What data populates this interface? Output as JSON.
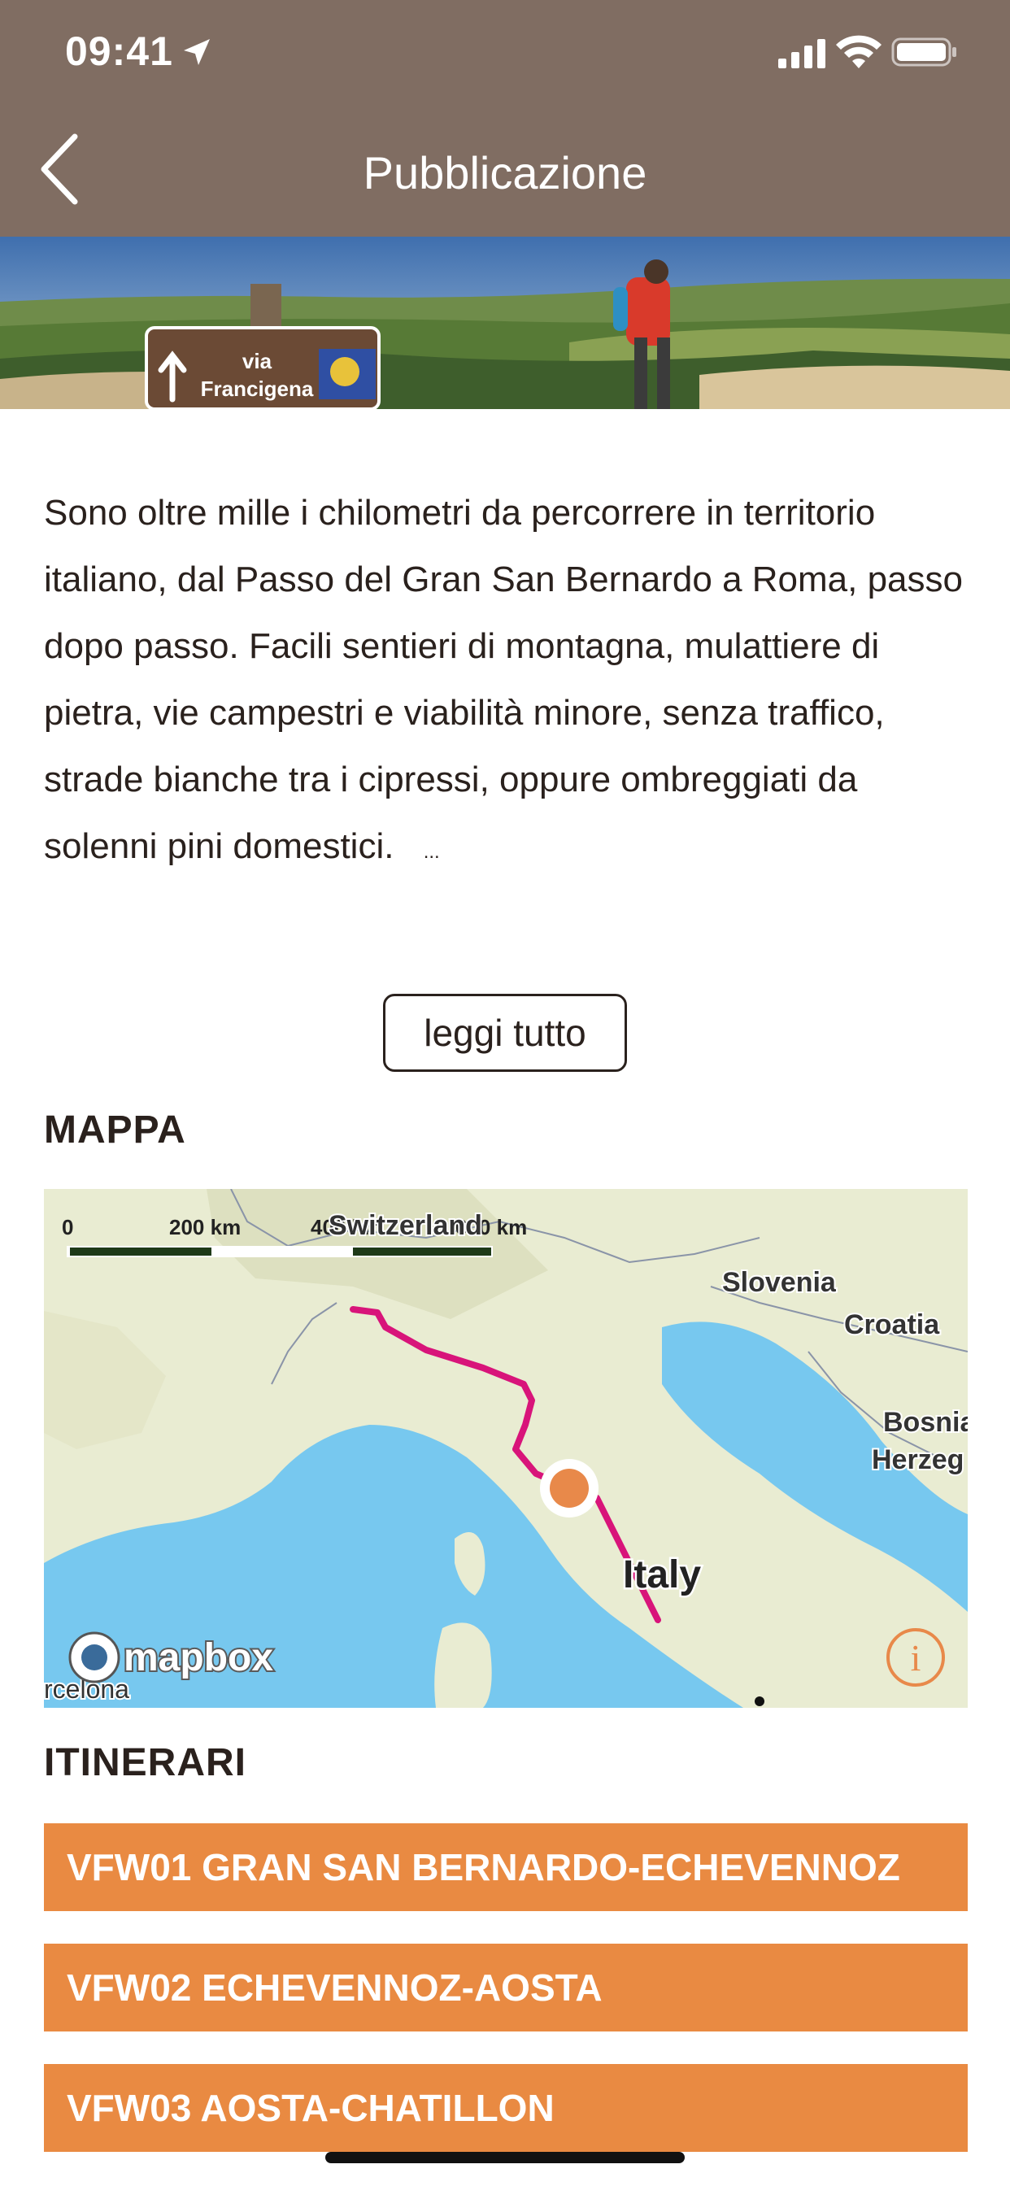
{
  "status_bar": {
    "time": "09:41"
  },
  "header": {
    "title": "Pubblicazione"
  },
  "hero": {
    "sign_line1": "via",
    "sign_line2": "Francigena"
  },
  "description": {
    "text": "Sono oltre mille i chilometri da percorrere in territorio italiano, dal Passo del Gran San Bernardo a Roma, passo dopo passo. Facili sentieri di montagna, mulattiere di pietra, vie campestri e viabilità minore, senza traffico, strade bianche tra i cipressi, oppure ombreggiati da solenni pini domestici.",
    "ellipsis": "..."
  },
  "read_more": {
    "label": "leggi tutto"
  },
  "map_section": {
    "title": "MAPPA",
    "scale": {
      "zero": "0",
      "mid": "200 km",
      "mid2": "400 km",
      "max": "600 km"
    },
    "labels": {
      "switzerland": "Switzerland",
      "slovenia": "Slovenia",
      "croatia": "Croatia",
      "bosnia": "Bosnia",
      "herzeg": "Herzeg",
      "italy": "Italy",
      "barcelona": "rcelona"
    },
    "logo": "mapbox",
    "info_symbol": "i",
    "colors": {
      "sea": "#77c8ef",
      "land": "#e9ecd2",
      "route": "#d8147a",
      "marker": "#e8894a"
    }
  },
  "itinerari": {
    "title": "ITINERARI",
    "items": [
      {
        "label": "VFW01 GRAN SAN BERNARDO-ECHEVENNOZ"
      },
      {
        "label": "VFW02 ECHEVENNOZ-AOSTA"
      },
      {
        "label": "VFW03 AOSTA-CHATILLON"
      }
    ]
  },
  "colors": {
    "header": "#806d62",
    "accent": "#e98a42",
    "text": "#2a211d"
  }
}
